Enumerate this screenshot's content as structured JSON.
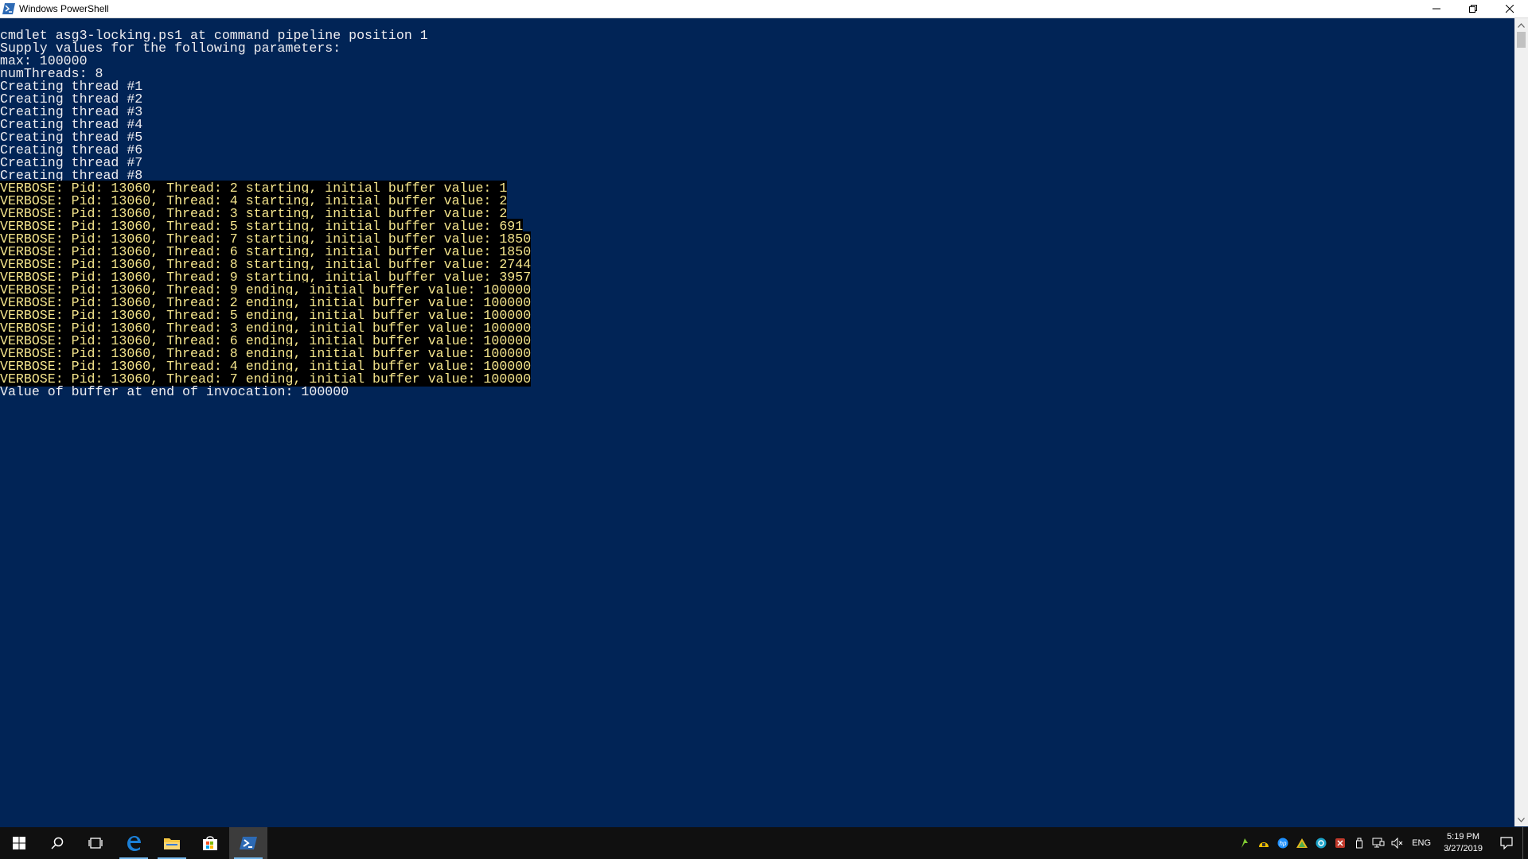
{
  "window": {
    "title": "Windows PowerShell",
    "controls": [
      "minimize",
      "restore",
      "close"
    ]
  },
  "console": {
    "lines": [
      {
        "text": "cmdlet asg3-locking.ps1 at command pipeline position 1",
        "type": "normal"
      },
      {
        "text": "Supply values for the following parameters:",
        "type": "normal"
      },
      {
        "text": "max: 100000",
        "type": "normal"
      },
      {
        "text": "numThreads: 8",
        "type": "normal"
      },
      {
        "text": "Creating thread #1",
        "type": "normal"
      },
      {
        "text": "Creating thread #2",
        "type": "normal"
      },
      {
        "text": "Creating thread #3",
        "type": "normal"
      },
      {
        "text": "Creating thread #4",
        "type": "normal"
      },
      {
        "text": "Creating thread #5",
        "type": "normal"
      },
      {
        "text": "Creating thread #6",
        "type": "normal"
      },
      {
        "text": "Creating thread #7",
        "type": "normal"
      },
      {
        "text": "Creating thread #8",
        "type": "normal"
      },
      {
        "text": "VERBOSE: Pid: 13060, Thread: 2 starting, initial buffer value: 1",
        "type": "verbose"
      },
      {
        "text": "VERBOSE: Pid: 13060, Thread: 4 starting, initial buffer value: 2",
        "type": "verbose"
      },
      {
        "text": "VERBOSE: Pid: 13060, Thread: 3 starting, initial buffer value: 2",
        "type": "verbose"
      },
      {
        "text": "VERBOSE: Pid: 13060, Thread: 5 starting, initial buffer value: 691",
        "type": "verbose"
      },
      {
        "text": "VERBOSE: Pid: 13060, Thread: 7 starting, initial buffer value: 1850",
        "type": "verbose"
      },
      {
        "text": "VERBOSE: Pid: 13060, Thread: 6 starting, initial buffer value: 1850",
        "type": "verbose"
      },
      {
        "text": "VERBOSE: Pid: 13060, Thread: 8 starting, initial buffer value: 2744",
        "type": "verbose"
      },
      {
        "text": "VERBOSE: Pid: 13060, Thread: 9 starting, initial buffer value: 3957",
        "type": "verbose"
      },
      {
        "text": "VERBOSE: Pid: 13060, Thread: 9 ending, initial buffer value: 100000",
        "type": "verbose"
      },
      {
        "text": "VERBOSE: Pid: 13060, Thread: 2 ending, initial buffer value: 100000",
        "type": "verbose"
      },
      {
        "text": "VERBOSE: Pid: 13060, Thread: 5 ending, initial buffer value: 100000",
        "type": "verbose"
      },
      {
        "text": "VERBOSE: Pid: 13060, Thread: 3 ending, initial buffer value: 100000",
        "type": "verbose"
      },
      {
        "text": "VERBOSE: Pid: 13060, Thread: 6 ending, initial buffer value: 100000",
        "type": "verbose"
      },
      {
        "text": "VERBOSE: Pid: 13060, Thread: 8 ending, initial buffer value: 100000",
        "type": "verbose"
      },
      {
        "text": "VERBOSE: Pid: 13060, Thread: 4 ending, initial buffer value: 100000",
        "type": "verbose"
      },
      {
        "text": "VERBOSE: Pid: 13060, Thread: 7 ending, initial buffer value: 100000",
        "type": "verbose"
      },
      {
        "text": "Value of buffer at end of invocation: 100000",
        "type": "normal"
      }
    ]
  },
  "colors": {
    "console_background": "#012456",
    "console_text": "#eeedf0",
    "verbose_text": "#f5e58c",
    "verbose_background": "#000000",
    "taskbar": "#101010",
    "taskbar_accent": "#76b9ed"
  },
  "taskbar": {
    "items": [
      {
        "name": "start-button",
        "icon": "windows-logo-icon"
      },
      {
        "name": "search-button",
        "icon": "search-icon"
      },
      {
        "name": "task-view-button",
        "icon": "task-view-icon"
      },
      {
        "name": "edge-button",
        "icon": "edge-icon"
      },
      {
        "name": "file-explorer-button",
        "icon": "folder-icon"
      },
      {
        "name": "store-button",
        "icon": "store-icon"
      },
      {
        "name": "powershell-button",
        "icon": "powershell-icon"
      }
    ],
    "tray_icons": [
      "tray-app-icon",
      "tray-app-icon",
      "hp-icon",
      "tray-app-icon",
      "tray-app-icon",
      "tray-app-icon",
      "usb-icon",
      "network-icon",
      "volume-muted-icon"
    ],
    "language": "ENG",
    "time": "5:19 PM",
    "date": "3/27/2019"
  }
}
